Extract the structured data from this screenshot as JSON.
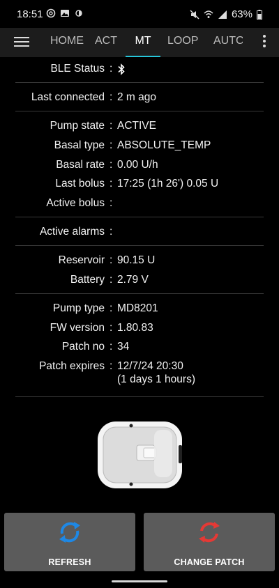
{
  "status_bar": {
    "time": "18:51",
    "battery": "63%",
    "icons_left": [
      "threads-icon",
      "image-icon",
      "contrast-icon"
    ],
    "icons_right": [
      "mute-icon",
      "wifi-icon",
      "signal-icon",
      "battery-icon"
    ]
  },
  "tabs": [
    {
      "label": "HOME",
      "active": false
    },
    {
      "label": "ACT",
      "active": false
    },
    {
      "label": "MT",
      "active": true
    },
    {
      "label": "LOOP",
      "active": false
    },
    {
      "label": "AUTC",
      "active": false
    }
  ],
  "info": {
    "ble_status": {
      "label": "BLE Status",
      "icon": "bluetooth-icon"
    },
    "last_connected": {
      "label": "Last connected",
      "value": "2 m ago"
    },
    "pump_state": {
      "label": "Pump state",
      "value": "ACTIVE"
    },
    "basal_type": {
      "label": "Basal type",
      "value": "ABSOLUTE_TEMP"
    },
    "basal_rate": {
      "label": "Basal rate",
      "value": "0.00 U/h"
    },
    "last_bolus": {
      "label": "Last bolus",
      "value": "17:25 (1h 26') 0.05 U"
    },
    "active_bolus": {
      "label": "Active bolus",
      "value": ""
    },
    "active_alarms": {
      "label": "Active alarms",
      "value": ""
    },
    "reservoir": {
      "label": "Reservoir",
      "value": "90.15 U"
    },
    "battery": {
      "label": "Battery",
      "value": "2.79 V"
    },
    "pump_type": {
      "label": "Pump type",
      "value": "MD8201"
    },
    "fw_version": {
      "label": "FW version",
      "value": "1.80.83"
    },
    "patch_no": {
      "label": "Patch no",
      "value": "34"
    },
    "patch_expires": {
      "label": "Patch expires",
      "value": "12/7/24 20:30",
      "value2": "(1 days 1 hours)"
    }
  },
  "colon": ":",
  "buttons": {
    "refresh": {
      "label": "REFRESH",
      "icon": "refresh-icon",
      "color": "#1e88e5"
    },
    "change_patch": {
      "label": "CHANGE PATCH",
      "icon": "change-patch-icon",
      "color": "#e53935"
    }
  },
  "accent_color": "#26c6da"
}
